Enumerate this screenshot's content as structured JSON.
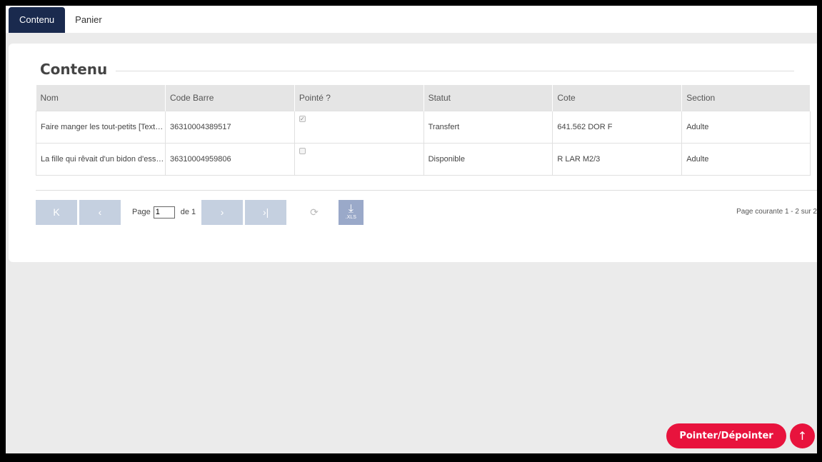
{
  "tabs": [
    {
      "label": "Contenu",
      "active": true
    },
    {
      "label": "Panier",
      "active": false
    }
  ],
  "section_title": "Contenu",
  "table": {
    "columns": [
      "Nom",
      "Code Barre",
      "Pointé ?",
      "Statut",
      "Cote",
      "Section"
    ],
    "rows": [
      {
        "nom": "Faire manger les tout-petits [Texte imp...",
        "code_barre": "36310004389517",
        "pointe": true,
        "statut": "Transfert",
        "cote": "641.562 DOR F",
        "section": "Adulte"
      },
      {
        "nom": "La fille qui rêvait d'un bidon d'essence ...",
        "code_barre": "36310004959806",
        "pointe": false,
        "statut": "Disponible",
        "cote": "R LAR M2/3",
        "section": "Adulte"
      }
    ]
  },
  "pager": {
    "first_icon": "first-page-icon",
    "prev_icon": "prev-page-icon",
    "next_icon": "next-page-icon",
    "last_icon": "last-page-icon",
    "page_label": "Page",
    "page_value": "1",
    "of_label": "de 1",
    "refresh_icon": "refresh-icon",
    "export_icon": "download-xls-icon",
    "export_text": ".XLS",
    "page_info": "Page courante 1 - 2 sur 2"
  },
  "actions": {
    "toggle_label": "Pointer/Dépointer",
    "scroll_top_icon": "arrow-up-icon"
  },
  "colors": {
    "tab_active": "#1a2a4e",
    "accent": "#e8133d",
    "pager_button": "#c5d0e0",
    "export_button": "#9aa9c9"
  }
}
